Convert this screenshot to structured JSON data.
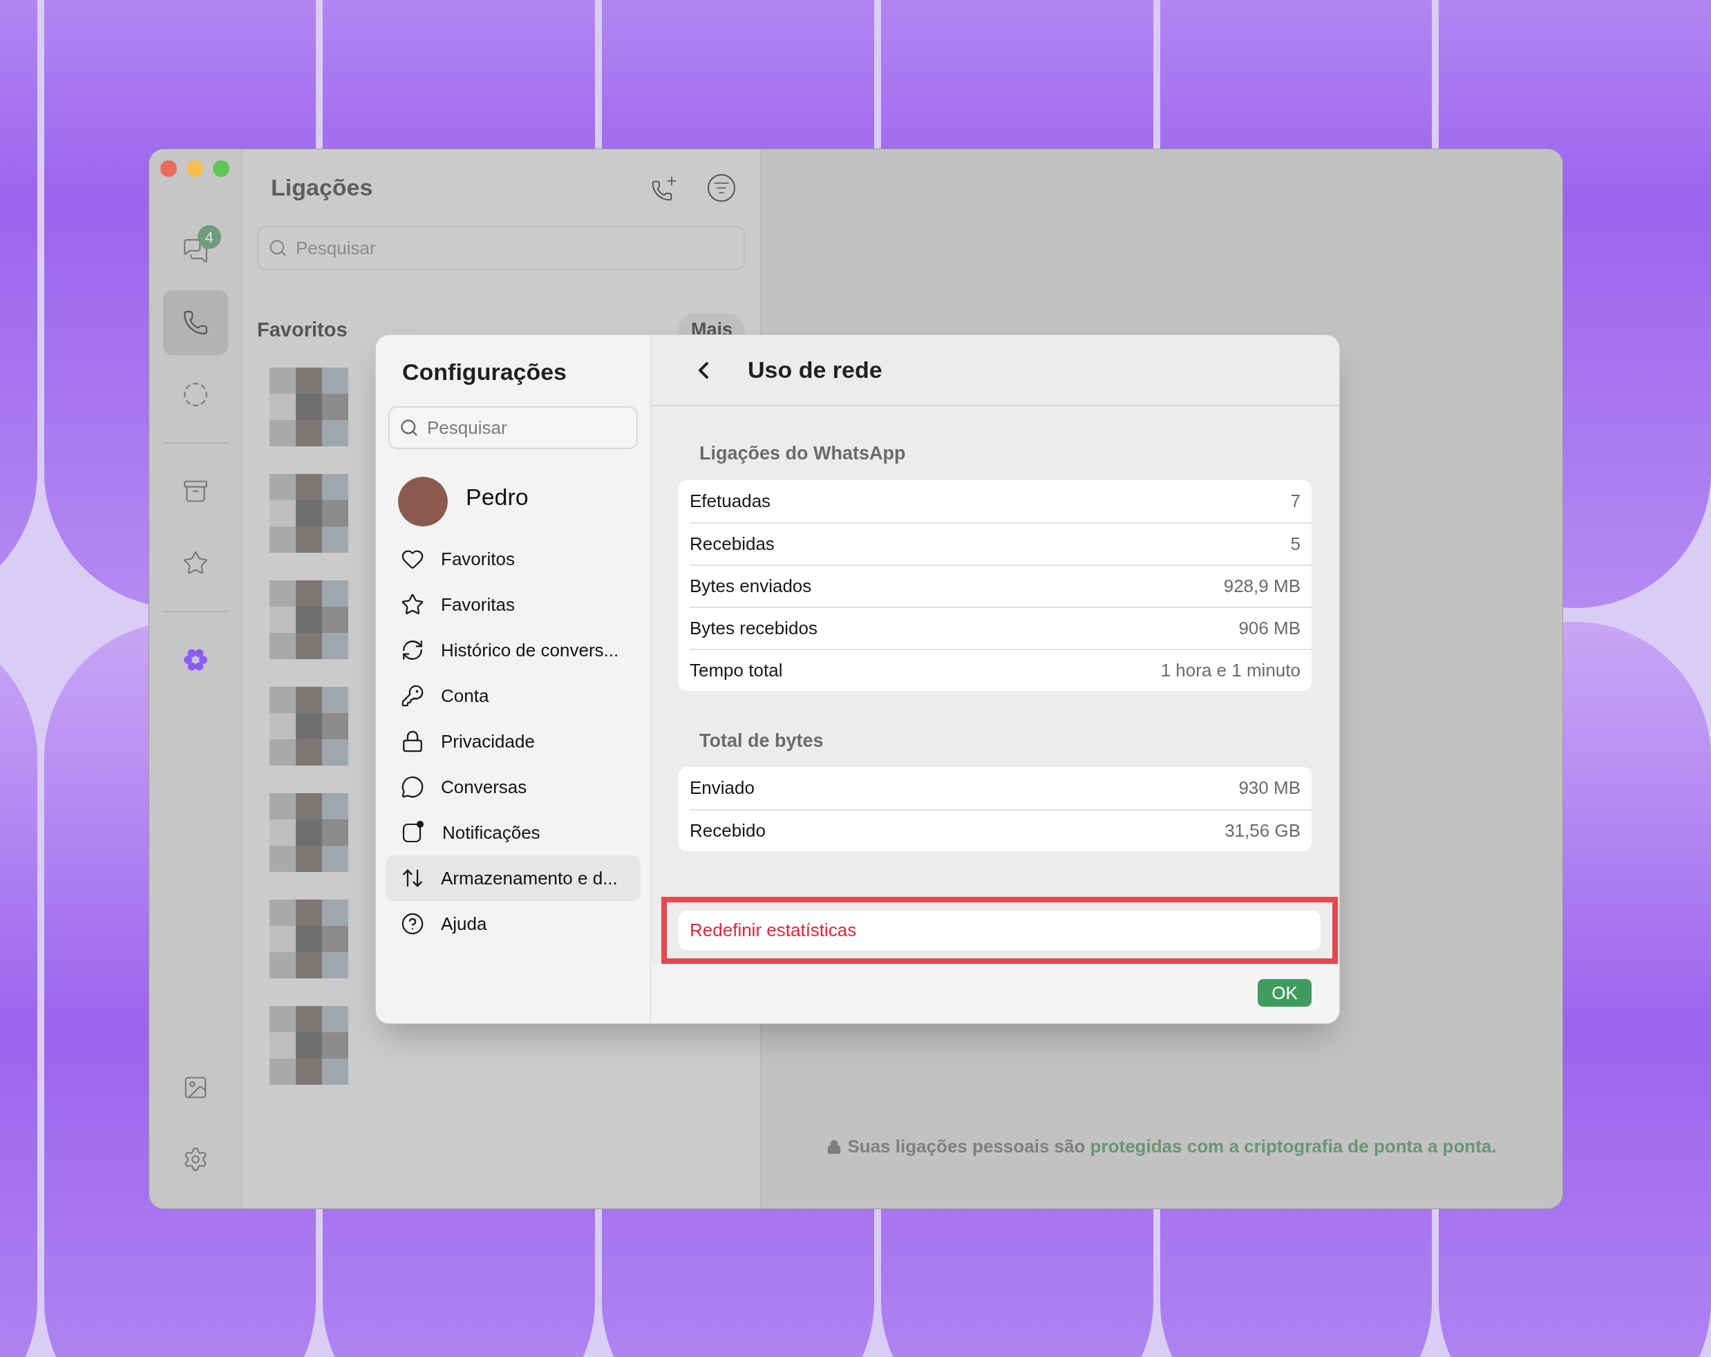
{
  "rail": {
    "top": [
      {
        "kind": "chats",
        "badge": "4",
        "selected": false
      },
      {
        "kind": "calls",
        "selected": true
      },
      {
        "kind": "status",
        "selected": false
      },
      {
        "kind": "divider"
      },
      {
        "kind": "archive",
        "selected": false
      },
      {
        "kind": "starred",
        "selected": false
      },
      {
        "kind": "divider"
      },
      {
        "kind": "ai",
        "selected": false
      }
    ],
    "bottom": [
      {
        "kind": "media",
        "selected": false
      },
      {
        "kind": "settings",
        "selected": false
      }
    ]
  },
  "calls_panel": {
    "title": "Ligações",
    "search": {
      "placeholder": "Pesquisar"
    },
    "favorites_heading": "Favoritos",
    "more_button": "Mais"
  },
  "settings": {
    "title": "Configurações",
    "search": {
      "placeholder": "Pesquisar"
    },
    "profile": {
      "name": "Pedro"
    },
    "items": [
      {
        "kind": "heart",
        "label": "Favoritos",
        "selected": false
      },
      {
        "kind": "star",
        "label": "Favoritas",
        "selected": false
      },
      {
        "kind": "sync",
        "label": "Histórico de convers...",
        "selected": false
      },
      {
        "kind": "key",
        "label": "Conta",
        "selected": false
      },
      {
        "kind": "lock",
        "label": "Privacidade",
        "selected": false
      },
      {
        "kind": "chat",
        "label": "Conversas",
        "selected": false
      },
      {
        "kind": "notification",
        "label": "Notificações",
        "selected": false
      },
      {
        "kind": "arrows",
        "label": "Armazenamento e d...",
        "selected": true
      },
      {
        "kind": "help",
        "label": "Ajuda",
        "selected": false
      }
    ]
  },
  "network_usage": {
    "title": "Uso de rede",
    "sections": [
      {
        "heading": "Ligações do WhatsApp",
        "rows": [
          {
            "label": "Efetuadas",
            "value": "7"
          },
          {
            "label": "Recebidas",
            "value": "5"
          },
          {
            "label": "Bytes enviados",
            "value": "928,9 MB"
          },
          {
            "label": "Bytes recebidos",
            "value": "906 MB"
          },
          {
            "label": "Tempo total",
            "value": "1 hora e 1 minuto"
          }
        ]
      },
      {
        "heading": "Total de bytes",
        "rows": [
          {
            "label": "Enviado",
            "value": "930 MB"
          },
          {
            "label": "Recebido",
            "value": "31,56 GB"
          }
        ]
      }
    ],
    "reset_button": {
      "label": "Redefinir estatísticas",
      "highlighted": true
    },
    "ok_button": "OK"
  },
  "footer": {
    "text": "Suas ligações pessoais são",
    "link": "protegidas com a criptografia de ponta a ponta."
  }
}
